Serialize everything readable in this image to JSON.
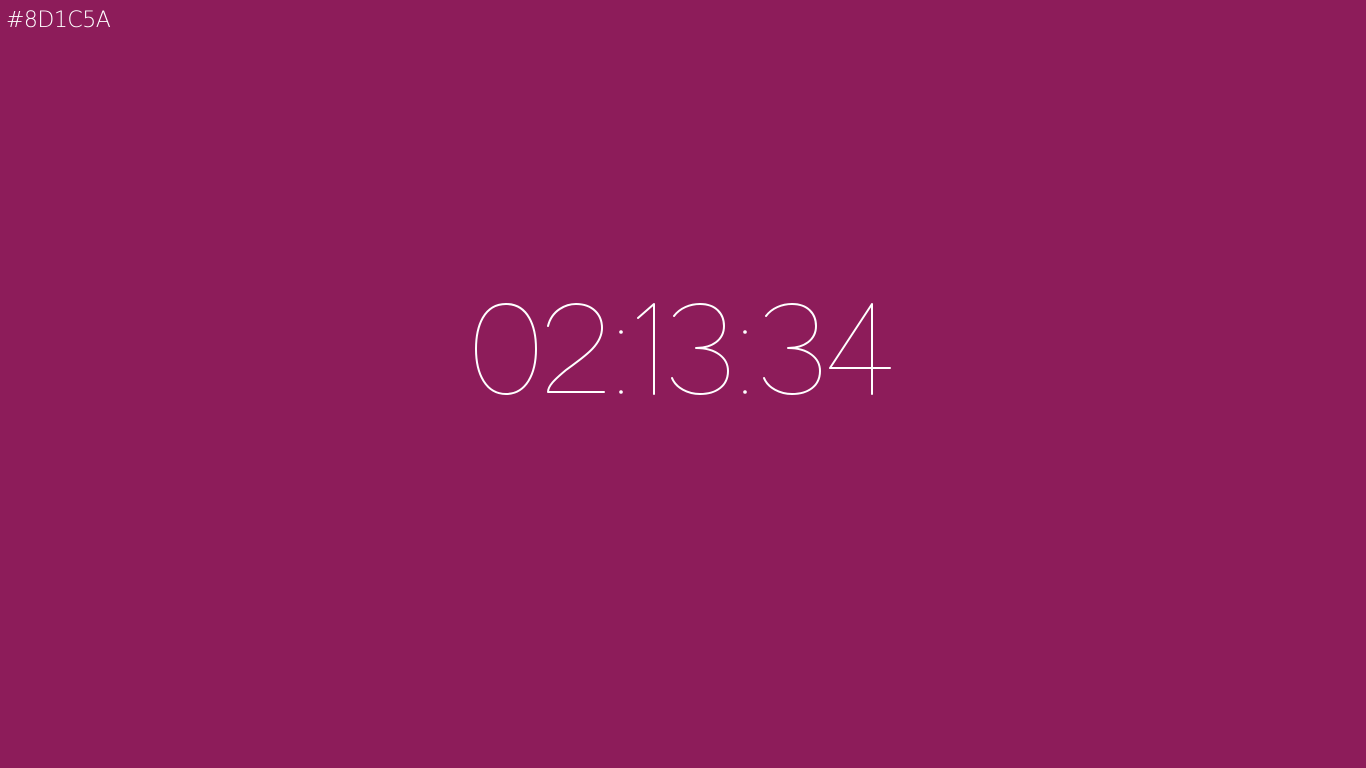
{
  "background_color": "#8D1C5A",
  "text_color": "#FFFFFF",
  "hex_label": "#8D1C5A",
  "clock": {
    "time": "02:13:34"
  }
}
